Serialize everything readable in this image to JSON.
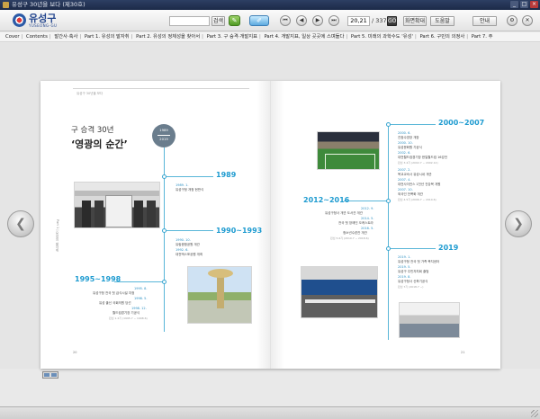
{
  "window": {
    "title": "유성구 30년을 보다 (제30호)"
  },
  "toolbar": {
    "search_placeholder": "",
    "search_label": "검색",
    "note_icon": "note-icon",
    "pen_icon": "pen-icon",
    "page_current": "20,21",
    "page_total": "/ 337",
    "go_label": "GO",
    "zoom_label": "화면확대",
    "help_label": "도움말",
    "info_label": "안내"
  },
  "logo": {
    "text": "유성구",
    "sub": "YUSEONG-GU"
  },
  "chapters": [
    "Cover",
    "Contents",
    "발간사·축사",
    "Part 1. 유성의 발자취",
    "Part 2. 유성의 정체성을 찾아서",
    "Part 3. 구 승격·개발지표",
    "Part 4. 개발지표, 일상 곳곳에 스며들다",
    "Part 5. 미래의 과학수도 '유성'",
    "Part 6. 구민의 의정사",
    "Part 7. 주"
  ],
  "page": {
    "left_header": "유성구 30년을 보다",
    "side_tab": "Part 1 | 유성의 발자취",
    "title_small": "구 승격 30년",
    "title_big": "‘영광의 순간’",
    "badge_top": "1989",
    "badge_bottom": "2019",
    "page_left": "20",
    "page_right": "21"
  },
  "timeline": {
    "e1989": {
      "era": "1989",
      "date": "1989. 1.",
      "text": "유성구청 개청 현판식"
    },
    "e1990": {
      "era": "1990~1993",
      "date1": "1990. 10.",
      "text1": "유림종합공원 개관",
      "date2": "1992. 6.",
      "text2": "대전엑스포공원 개최"
    },
    "e1995": {
      "era": "1995~1998",
      "date1": "1995. 8.",
      "text1": "유성구청 전국 첫 급식시설 지정",
      "date2": "1998. 5.",
      "text2": "유성 출신 국회의원 당선",
      "date3": "1998. 12.",
      "text3": "월드컵경기장 기공식",
      "src": "민선 1·2기 (1995.7 ~ 1998.6)"
    },
    "e2000": {
      "era": "2000~2007",
      "date1": "2000. 6.",
      "text1": "진잠수영장 개장",
      "date2": "2000. 10.",
      "text2": "유성문화원 기공식",
      "date3": "2002. 6.",
      "text3": "대전월드컵경기장 한일월드컵 16강전",
      "src1": "민선 3·4기 (2002.7 ~ 2002.12)",
      "date4": "2007. 2.",
      "text4": "목교교숙사 유성시네 개관",
      "date5": "2007. 4.",
      "text5": "대전사이언스 1천년 건강복 개원",
      "date6": "2007. 10.",
      "text6": "외국인 전폭화 개관",
      "src2": "민선 4·5기 (2006.7 ~ 2010.6)"
    },
    "e2012": {
      "era": "2012~2016",
      "date1": "2012. 9.",
      "text1": "유성구청사 개관 도서관 개관",
      "date2": "2014. 5.",
      "text2": "전국 첫 장애인 오케스트라",
      "date3": "2016. 5.",
      "text3": "청소년수련관 개관",
      "src": "민선 5·6기 (2010.7 ~ 2018.6)"
    },
    "e2019": {
      "era": "2019",
      "date1": "2019. 1.",
      "text1": "유성구청 전국 첫 가족 복지센터",
      "date2": "2019. 5.",
      "text2": "유성구 주민자치회 출범",
      "date3": "2019. 8.",
      "text3": "유성구청사 신축기공식",
      "src": "민선 7기 (2018.7 ~)"
    }
  },
  "icons": {
    "prev": "chevron-left-icon",
    "next": "chevron-right-icon"
  }
}
